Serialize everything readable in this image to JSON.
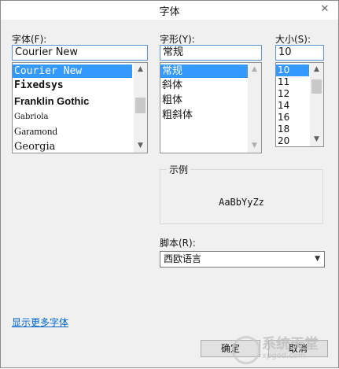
{
  "window": {
    "title": "字体",
    "close_icon": "✕"
  },
  "font": {
    "label": "字体(F):",
    "value": "Courier New",
    "items": [
      "Courier New",
      "Fixedsys",
      "Franklin Gothic",
      "Gabriola",
      "Garamond",
      "Georgia"
    ],
    "selected_index": 0
  },
  "style": {
    "label": "字形(Y):",
    "value": "常规",
    "items": [
      "常规",
      "斜体",
      "粗体",
      "粗斜体"
    ],
    "selected_index": 0
  },
  "size": {
    "label": "大小(S):",
    "value": "10",
    "items": [
      "10",
      "11",
      "12",
      "14",
      "16",
      "18",
      "20"
    ],
    "selected_index": 0
  },
  "sample": {
    "label": "示例",
    "text": "AaBbYyZz"
  },
  "script": {
    "label": "脚本(R):",
    "value": "西欧语言"
  },
  "more_fonts_link": "显示更多字体",
  "buttons": {
    "ok": "确定",
    "cancel": "取消"
  },
  "watermark": {
    "text": "系统天堂",
    "sub": "xpgod.com"
  },
  "colors": {
    "selection": "#3399ff",
    "link": "#0066cc",
    "focus_border": "#5e94d6"
  }
}
